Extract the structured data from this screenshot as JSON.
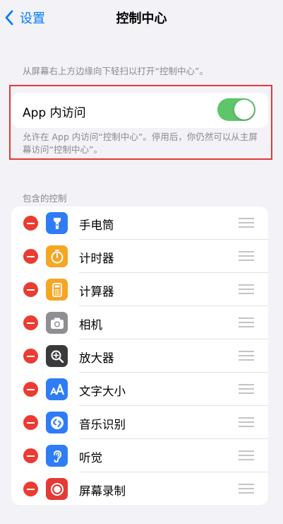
{
  "nav": {
    "back_label": "设置",
    "title": "控制中心"
  },
  "hint": "从屏幕右上方边缘向下轻扫以打开“控制中心”。",
  "app_access": {
    "label": "App 内访问",
    "enabled": true,
    "description": "允许在 App 内访问“控制中心”。停用后，你仍然可以从主屏幕访问“控制中心”。"
  },
  "section_header": "包含的控制",
  "controls": [
    {
      "label": "手电筒",
      "icon": "flashlight-icon",
      "color": "#2f7cf6"
    },
    {
      "label": "计时器",
      "icon": "timer-icon",
      "color": "#f5a623"
    },
    {
      "label": "计算器",
      "icon": "calculator-icon",
      "color": "#f5a623"
    },
    {
      "label": "相机",
      "icon": "camera-icon",
      "color": "#8e8e93"
    },
    {
      "label": "放大器",
      "icon": "magnifier-icon",
      "color": "#3a3a3c"
    },
    {
      "label": "文字大小",
      "icon": "text-size-icon",
      "color": "#2f7cf6"
    },
    {
      "label": "音乐识别",
      "icon": "shazam-icon",
      "color": "#2f7cf6"
    },
    {
      "label": "听觉",
      "icon": "hearing-icon",
      "color": "#2f7cf6"
    },
    {
      "label": "屏幕录制",
      "icon": "screen-record-icon",
      "color": "#e53935"
    }
  ]
}
